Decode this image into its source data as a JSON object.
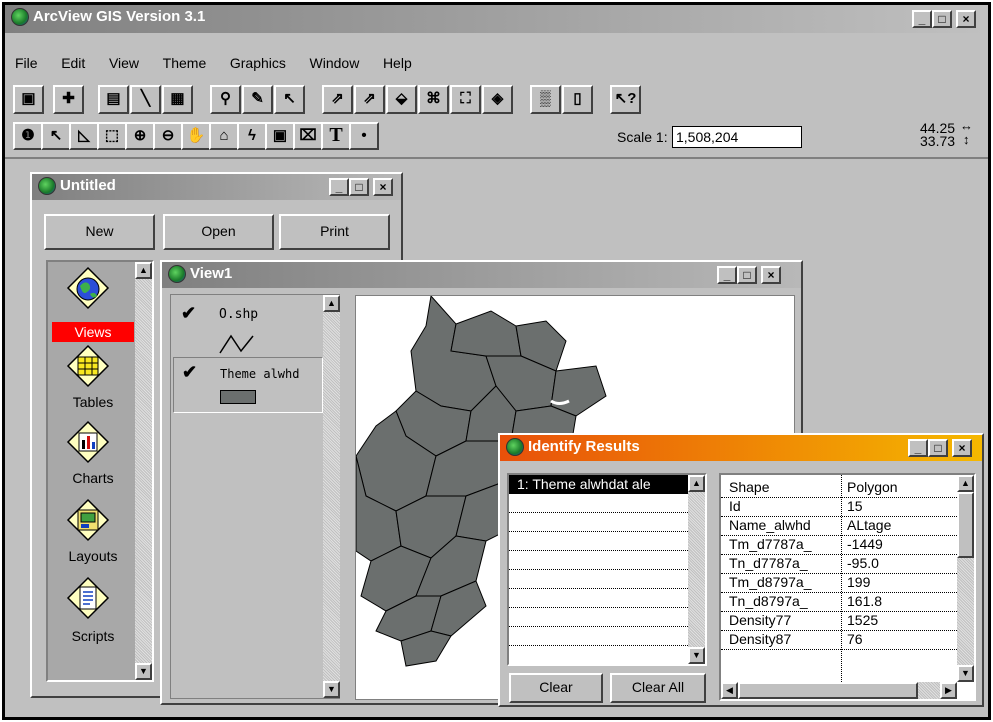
{
  "app": {
    "title": "ArcView GIS Version 3.1",
    "menu": [
      "File",
      "Edit",
      "View",
      "Theme",
      "Graphics",
      "Window",
      "Help"
    ],
    "scale_label": "Scale 1:",
    "scale_value": "1,508,204",
    "coord_x": "44.25",
    "coord_y": "33.73",
    "window_buttons": [
      "_",
      "□",
      "×"
    ]
  },
  "toolbar_buttons": [
    "save-icon",
    "add-theme-icon",
    "theme-properties-icon",
    "edit-legend-icon",
    "open-table-icon",
    "find-icon",
    "locate-address-icon",
    "query-builder-icon",
    "zoom-to-full-extent-icon",
    "zoom-to-active-themes-icon",
    "zoom-to-selected-icon",
    "zoom-in-fixed-icon",
    "zoom-out-fixed-icon",
    "zoom-previous-icon",
    "select-by-theme-icon",
    "clear-selected-icon",
    "help-icon"
  ],
  "tools": [
    "identify-icon",
    "pointer-icon",
    "vertex-edit-icon",
    "select-feature-icon",
    "zoom-in-icon",
    "zoom-out-icon",
    "pan-icon",
    "measure-icon",
    "hotlink-icon",
    "area-of-interest-icon",
    "label-icon",
    "text-icon",
    "draw-point-icon"
  ],
  "project_window": {
    "title": "Untitled",
    "buttons": [
      "New",
      "Open",
      "Print"
    ],
    "items": [
      {
        "label": "Views",
        "icon": "views-icon",
        "selected": true
      },
      {
        "label": "Tables",
        "icon": "tables-icon",
        "selected": false
      },
      {
        "label": "Charts",
        "icon": "charts-icon",
        "selected": false
      },
      {
        "label": "Layouts",
        "icon": "layouts-icon",
        "selected": false
      },
      {
        "label": "Scripts",
        "icon": "scripts-icon",
        "selected": false
      }
    ],
    "selected_color": "#ff0000"
  },
  "view_window": {
    "title": "View1",
    "themes": [
      {
        "name": "O.shp",
        "checked": true,
        "symbol": "line"
      },
      {
        "name": "Theme alwhd",
        "checked": true,
        "symbol": "polygon"
      }
    ],
    "polygon_color": "#6b6f6e"
  },
  "identify_window": {
    "title": "Identify Results",
    "results": [
      "1: Theme alwhdat ale"
    ],
    "buttons": [
      "Clear",
      "Clear All"
    ],
    "attributes": [
      {
        "field": "Shape",
        "value": "Polygon"
      },
      {
        "field": "Id",
        "value": "15"
      },
      {
        "field": "Name_alwhd",
        "value": "ALtage"
      },
      {
        "field": "Tm_d7787a_",
        "value": "-1449"
      },
      {
        "field": "Tn_d7787a_",
        "value": "-95.0"
      },
      {
        "field": "Tm_d8797a_",
        "value": "199"
      },
      {
        "field": "Tn_d8797a_",
        "value": "161.8"
      },
      {
        "field": "Density77",
        "value": "1525"
      },
      {
        "field": "Density87",
        "value": "76"
      }
    ]
  }
}
